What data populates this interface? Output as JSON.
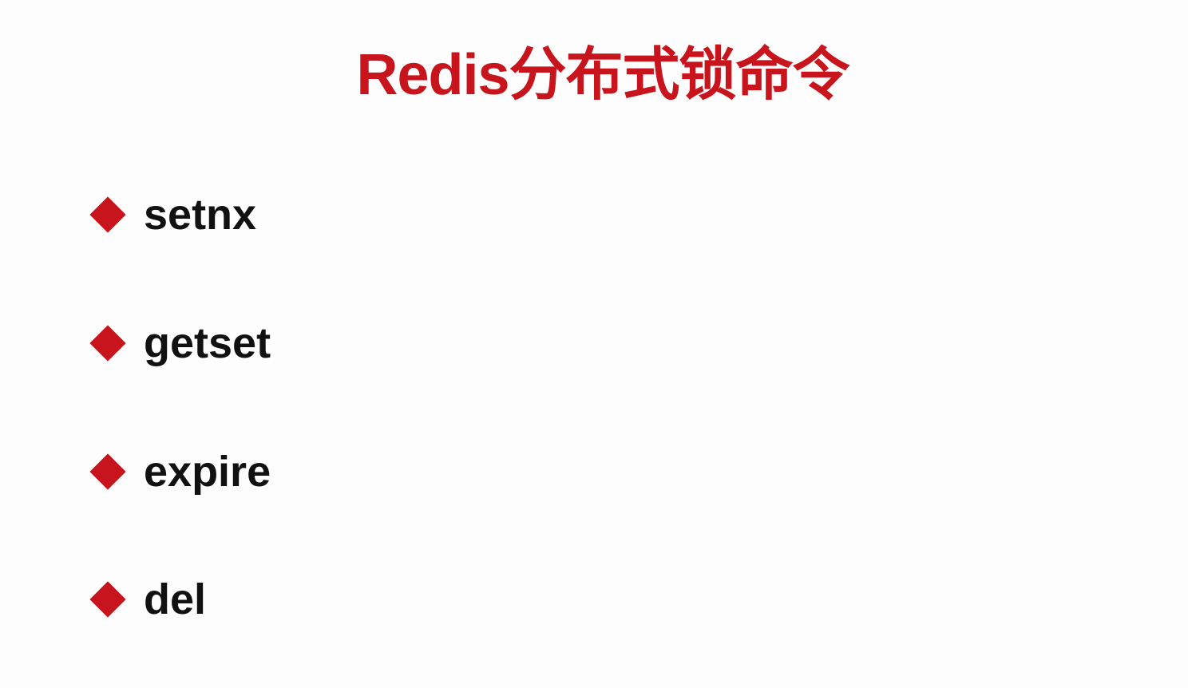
{
  "slide": {
    "title": "Redis分布式锁命令",
    "accent_color": "#c8141c",
    "items": [
      {
        "label": "setnx"
      },
      {
        "label": "getset"
      },
      {
        "label": "expire"
      },
      {
        "label": "del"
      }
    ]
  }
}
